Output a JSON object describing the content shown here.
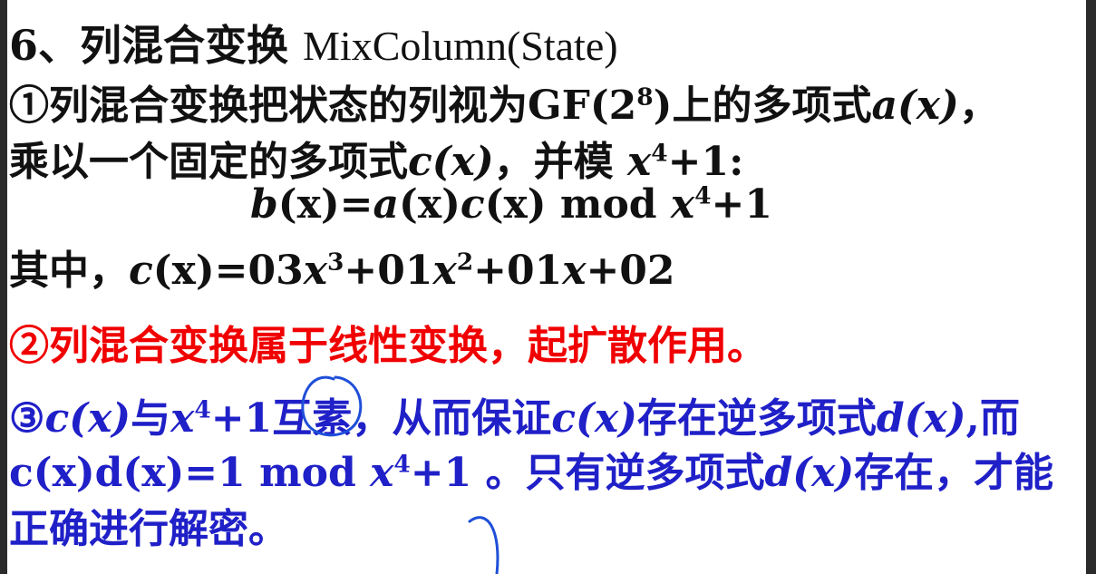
{
  "title": {
    "num": "6、列混合变换",
    "en": "MixColumn(State)"
  },
  "line1": {
    "text": "①列混合变换把状态的列视为",
    "gf": "GF(2",
    "gf_sup": "8",
    "gf_end": ")",
    "mid": "上的多项式",
    "a": "a",
    "x": "(x)",
    "comma": "，"
  },
  "line2": {
    "text": "乘以一个固定的多项式",
    "c": "c",
    "x": "(x)",
    "mid": "，并模 ",
    "var": "x",
    "sup": "4",
    "end": "+1:"
  },
  "line3": {
    "b": "b",
    "p1": "(x)=",
    "a": "a",
    "p2": "(x)",
    "c": "c",
    "p3": "(x)  mod ",
    "var": "x",
    "sup": "4",
    "end": "+1"
  },
  "line4": {
    "text": "其中，",
    "c": "c",
    "p1": "(x)=03",
    "x1": "x",
    "s1": "3",
    "p2": "+01",
    "x2": "x",
    "s2": "2",
    "p3": "+01",
    "x3": "x",
    "p4": "+02"
  },
  "line5": {
    "text": "②列混合变换属于线性变换，起扩散作用。"
  },
  "line6": {
    "start": "③",
    "c": "c",
    "x": "(x)",
    "mid1": "与",
    "var": "x",
    "sup": "4",
    "mid2": "+1互素，从而保证",
    "c2": "c",
    "x2": "(x)",
    "mid3": "存在逆多项式",
    "d": "d",
    "x3": "(x)",
    "end": ",而"
  },
  "line7": {
    "p1": "c(x)d(x)=1   mod ",
    "var": "x",
    "sup": "4",
    "p2": "+1 。只有逆多项式",
    "d": "d",
    "x": "(x)",
    "end": "存在，才能"
  },
  "line8": {
    "text": "正确进行解密。"
  },
  "colors": {
    "red": "#f00000",
    "blue": "#2020c8",
    "black": "#111111"
  }
}
